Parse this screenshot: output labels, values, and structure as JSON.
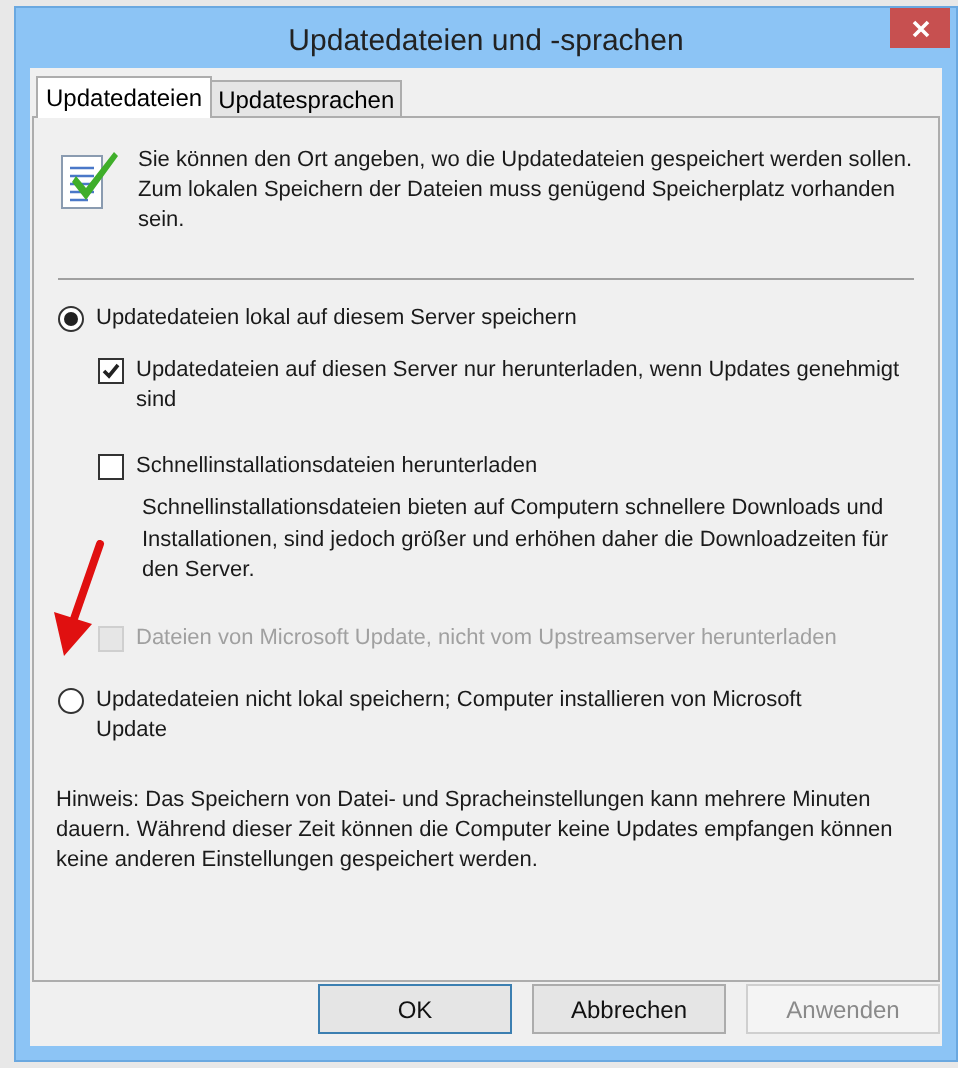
{
  "window": {
    "title": "Updatedateien und -sprachen"
  },
  "tabs": [
    {
      "label": "Updatedateien",
      "selected": true
    },
    {
      "label": "Updatesprachen",
      "selected": false
    }
  ],
  "info": {
    "text": "Sie können den Ort angeben, wo die Updatedateien gespeichert werden sollen. Zum lokalen Speichern der Dateien muss genügend Speicherplatz vorhanden sein."
  },
  "options": [
    {
      "kind": "radio",
      "label": "Updatedateien lokal auf diesem Server speichern",
      "selected": true,
      "children": [
        {
          "kind": "checkbox",
          "label": "Updatedateien auf diesen Server nur herunterladen, wenn Updates genehmigt sind",
          "checked": true,
          "disabled": false
        },
        {
          "kind": "checkbox",
          "label": "Schnellinstallationsdateien herunterladen",
          "checked": false,
          "disabled": false,
          "description": "Schnellinstallationsdateien bieten auf Computern schnellere Downloads und Installationen, sind jedoch größer und erhöhen daher die Downloadzeiten für den Server."
        },
        {
          "kind": "checkbox",
          "label": "Dateien von Microsoft Update, nicht vom Upstreamserver herunterladen",
          "checked": false,
          "disabled": true
        }
      ]
    },
    {
      "kind": "radio",
      "label": "Updatedateien nicht lokal speichern; Computer installieren von Microsoft Update",
      "selected": false
    }
  ],
  "note": "Hinweis: Das Speichern von Datei- und Spracheinstellungen kann mehrere Minuten dauern. Während dieser Zeit können die Computer keine Updates empfangen können keine anderen Einstellungen gespeichert werden.",
  "buttons": [
    {
      "label": "OK",
      "default": true,
      "disabled": false
    },
    {
      "label": "Abbrechen",
      "default": false,
      "disabled": false
    },
    {
      "label": "Anwenden",
      "default": false,
      "disabled": true
    }
  ]
}
